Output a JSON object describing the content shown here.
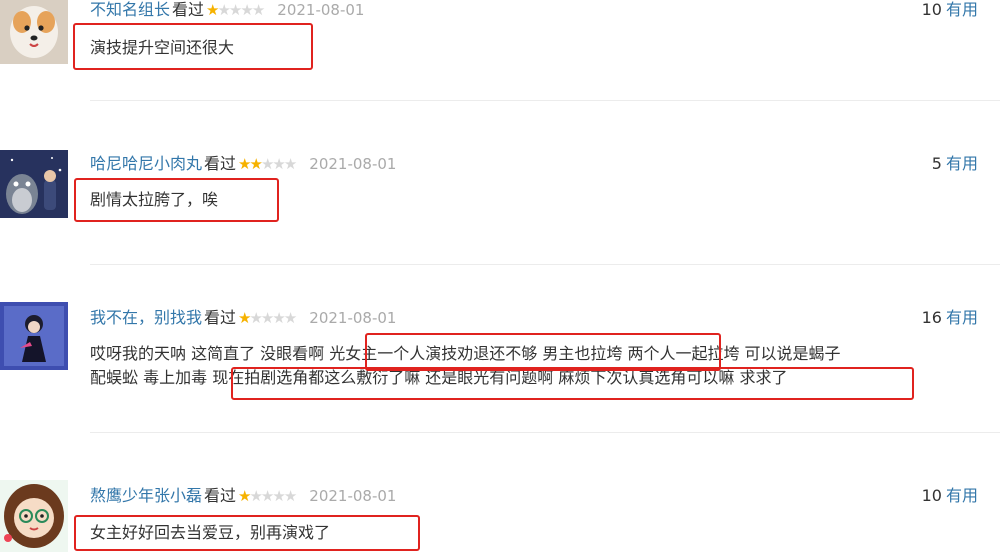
{
  "reviews": [
    {
      "user": "不知名组长",
      "watched": "看过",
      "rating": 1,
      "date": "2021-08-01",
      "useful_count": "10",
      "useful_label": "有用",
      "text": "演技提升空间还很大",
      "avatar_icon": "dog-avatar-icon"
    },
    {
      "user": "哈尼哈尼小肉丸",
      "watched": "看过",
      "rating": 2,
      "date": "2021-08-01",
      "useful_count": "5",
      "useful_label": "有用",
      "text": "剧情太拉胯了，唉",
      "avatar_icon": "totoro-avatar-icon"
    },
    {
      "user": "我不在，别找我",
      "watched": "看过",
      "rating": 1,
      "date": "2021-08-01",
      "useful_count": "16",
      "useful_label": "有用",
      "text_line1_a": "哎呀我的天呐 这简直了 没眼看啊 ",
      "text_line1_b": "光女主一个人演技劝退还不够 男主也拉垮",
      "text_line1_c": " 两个人一起拉垮 可以说是蝎子",
      "text_line2_a": "配蜈蚣 毒上加毒 ",
      "text_line2_b": "现在拍剧选角都这么敷衍了嘛 还是眼光有问题啊 麻烦下次认真选角可以嘛 求求了",
      "avatar_icon": "anime-figure-avatar-icon"
    },
    {
      "user": "熬鹰少年张小磊",
      "watched": "看过",
      "rating": 1,
      "date": "2021-08-01",
      "useful_count": "10",
      "useful_label": "有用",
      "text": "女主好好回去当爱豆，别再演戏了",
      "avatar_icon": "cartoon-girl-avatar-icon"
    }
  ],
  "colors": {
    "link": "#3377aa",
    "star_on": "#f6b200",
    "star_off": "#d8d8d8",
    "highlight_box": "#e0231f"
  }
}
